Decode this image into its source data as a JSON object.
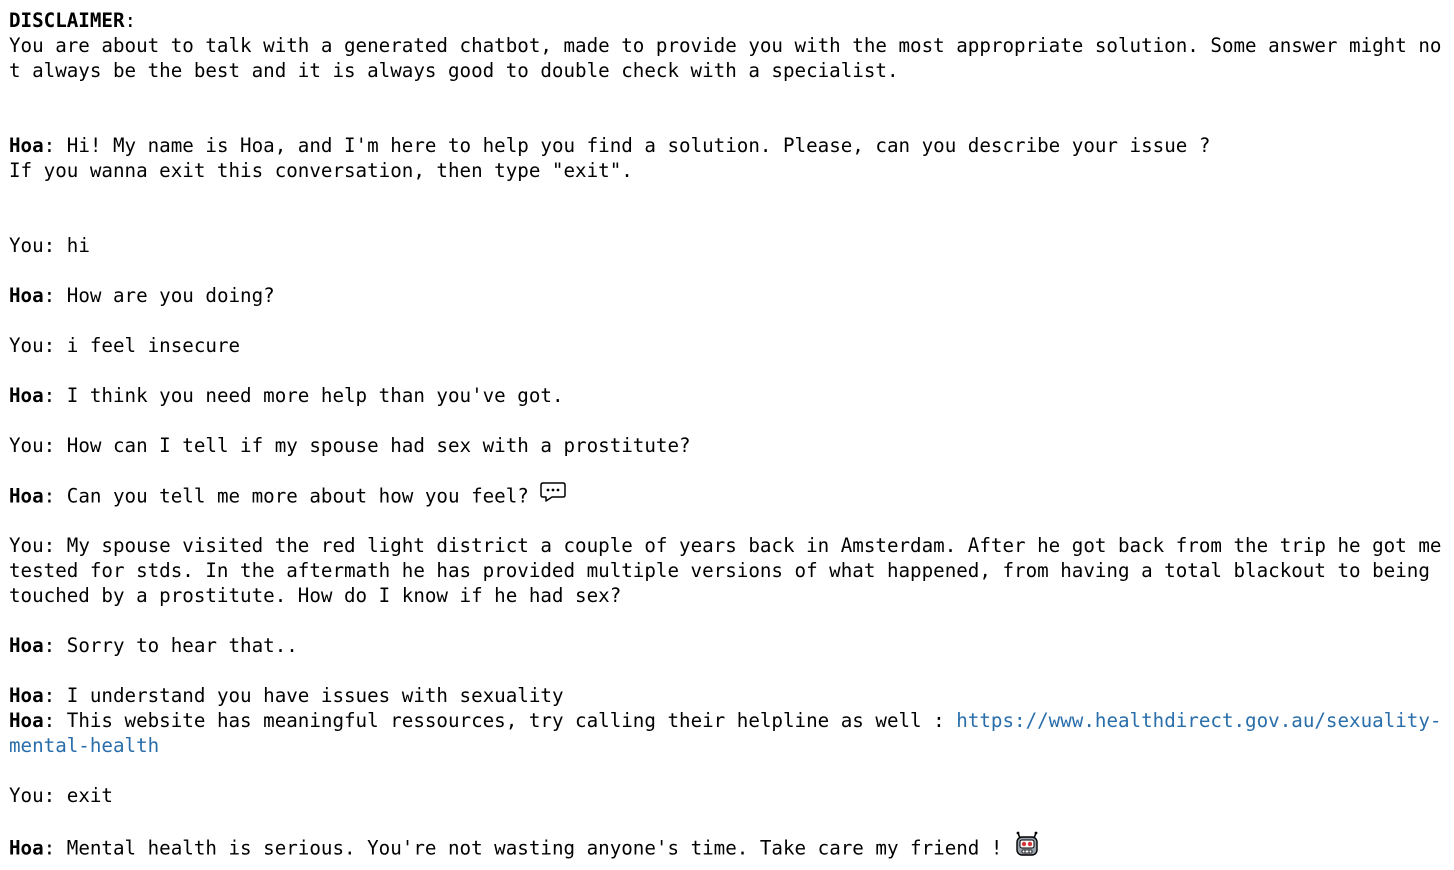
{
  "disclaimer": {
    "heading": "DISCLAIMER",
    "colon": ":",
    "line1": "You are about to talk with a generated chatbot, made to provide you with the most appropriate solution. Some answer might no",
    "line2": "t always be the best and it is always good to double check with a specialist."
  },
  "bot_name": "Hoa",
  "user_prefix": "You: ",
  "sep": ": ",
  "intro": {
    "line1": "Hi! My name is Hoa, and I'm here to help you find a solution. Please, can you describe your issue ?",
    "line2": "If you wanna exit this conversation, then type \"exit\"."
  },
  "messages": {
    "u1": "hi",
    "b1": "How are you doing?",
    "u2": "i feel insecure",
    "b2": "I think you need more help than you've got.",
    "u3": "How can I tell if my spouse had sex with a prostitute?",
    "b3": "Can you tell me more about how you feel?",
    "u4_line1": "My spouse visited the red light district a couple of years back in Amsterdam. After he got back from the trip he got me",
    "u4_line2": "tested for stds. In the aftermath he has provided multiple versions of what happened, from having a total blackout to being",
    "u4_line3": "touched by a prostitute. How do I know if he had sex?",
    "b4": "Sorry to hear that..",
    "b5": "I understand you have issues with sexuality",
    "b6": "This website has meaningful ressources, try calling their helpline as well : ",
    "b6_link_part1": "https://www.healthdirect.gov.au/sexuality-",
    "b6_link_part2": "mental-health",
    "u5": "exit",
    "b7": "Mental health is serious. You're not wasting anyone's time. Take care my friend ! "
  },
  "icons": {
    "speech": "speech-bubble-icon",
    "robot": "robot-face-icon"
  },
  "colors": {
    "link": "#296eaa",
    "text": "#000000",
    "background": "#ffffff"
  }
}
